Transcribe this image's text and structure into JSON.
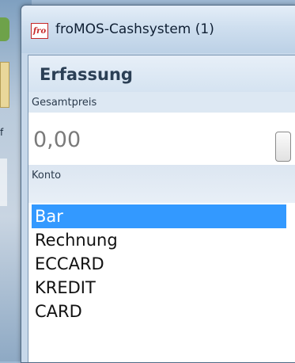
{
  "window": {
    "title": "froMOS-Cashsystem (1)",
    "icon": "fromos-app-icon",
    "icon_glyph": "fro"
  },
  "panel": {
    "title": "Erfassung"
  },
  "price": {
    "label": "Gesamtpreis",
    "value": "0,00"
  },
  "account": {
    "label": "Konto",
    "options": [
      {
        "label": "Bar",
        "selected": true
      },
      {
        "label": "Rechnung",
        "selected": false
      },
      {
        "label": "ECCARD",
        "selected": false
      },
      {
        "label": "KREDIT",
        "selected": false
      },
      {
        "label": "CARD",
        "selected": false
      }
    ]
  },
  "desktop": {
    "partial_text": "f"
  },
  "colors": {
    "selection": "#3399ff",
    "title_text": "#2b3f55"
  }
}
